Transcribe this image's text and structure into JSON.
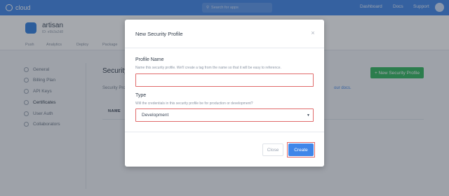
{
  "nav": {
    "brand": "cloud",
    "search_placeholder": "Search for apps",
    "links": [
      "Dashboard",
      "Docs",
      "Support"
    ]
  },
  "app": {
    "name": "artisan",
    "id": "ID: e9b3a2d8",
    "tabs": [
      "Push",
      "Analytics",
      "Deploy",
      "Package"
    ]
  },
  "sidebar": {
    "items": [
      {
        "label": "General",
        "icon": "gear-icon"
      },
      {
        "label": "Billing Plan",
        "icon": "card-icon"
      },
      {
        "label": "API Keys",
        "icon": "key-icon"
      },
      {
        "label": "Certificates",
        "icon": "certificate-icon"
      },
      {
        "label": "User Auth",
        "icon": "user-icon"
      },
      {
        "label": "Collaborators",
        "icon": "people-icon"
      }
    ],
    "active": "Certificates"
  },
  "main": {
    "title": "Security Profiles",
    "description": "Security Profiles",
    "description_tail": "our docs.",
    "new_button": "+ New Security Profile",
    "table_header": "NAME"
  },
  "modal": {
    "title": "New Security Profile",
    "close_symbol": "×",
    "profile_name": {
      "label": "Profile Name",
      "help": "Name this security profile. We'll create a tag from the name so that it will be easy to reference.",
      "value": "",
      "placeholder": ""
    },
    "type": {
      "label": "Type",
      "help": "Will the credentials in this security profile be for production or development?",
      "selected": "Development"
    },
    "close_button": "Close",
    "create_button": "Create"
  },
  "colors": {
    "nav_blue": "#3f86e9",
    "create_blue": "#3f86e9",
    "new_button_green": "#2fb55a",
    "highlight_red": "#e06b6b"
  }
}
